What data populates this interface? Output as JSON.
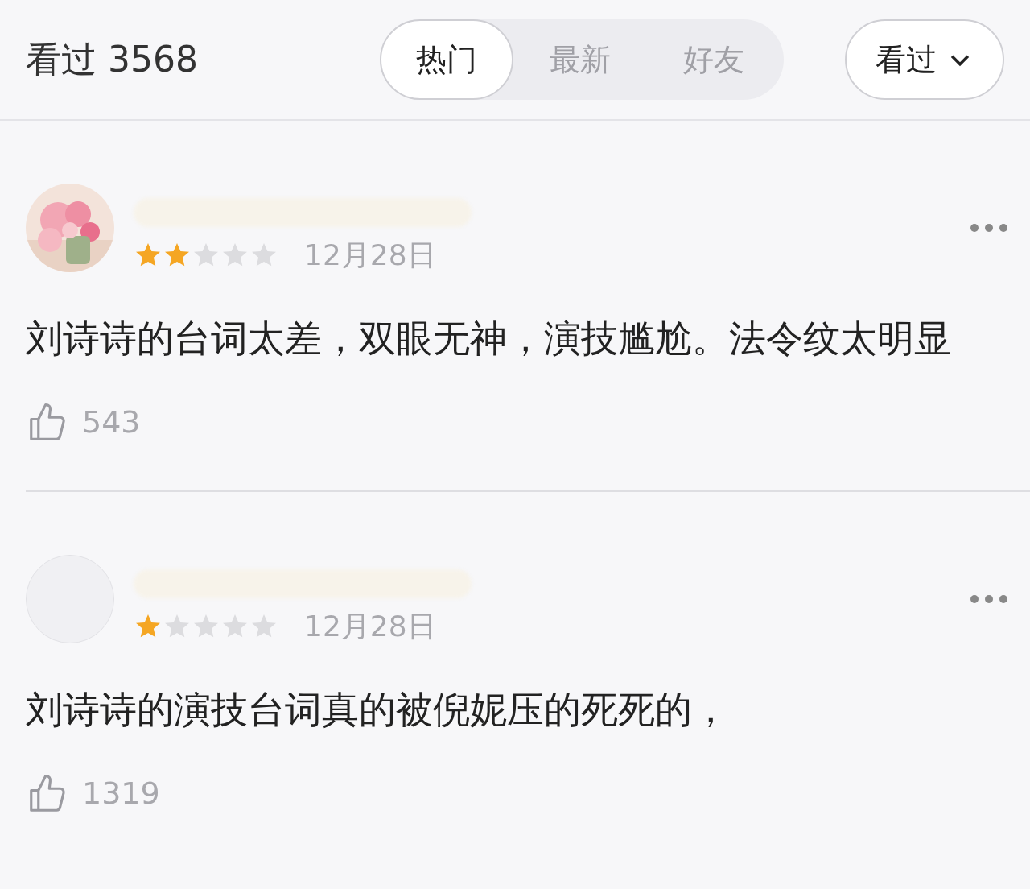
{
  "header": {
    "title": "看过 3568",
    "tabs": [
      {
        "label": "热门",
        "selected": true
      },
      {
        "label": "最新",
        "selected": false
      },
      {
        "label": "好友",
        "selected": false
      }
    ],
    "filter": {
      "label": "看过"
    }
  },
  "reviews": [
    {
      "stars": 2,
      "date": "12月28日",
      "text": "刘诗诗的台词太差，双眼无神，演技尴尬。法令纹太明显",
      "likes": "543"
    },
    {
      "avatar": {
        "kind": "blank"
      },
      "stars": 1,
      "date": "12月28日",
      "text": "刘诗诗的演技台词真的被倪妮压的死死的，",
      "likes": "1319"
    }
  ]
}
